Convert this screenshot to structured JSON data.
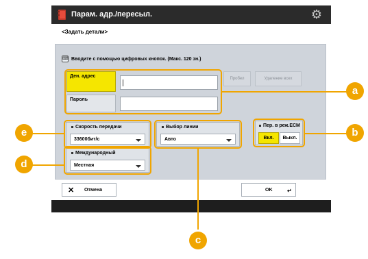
{
  "header": {
    "title": "Парам. адр./пересыл."
  },
  "subtitle": "<Задать детали>",
  "hint": "Вводите с помощью цифровых кнопок. (Макс. 120 зн.)",
  "fields": {
    "dest_label": "Ден. адрес",
    "password_label": "Пароль",
    "dest_value": "",
    "password_value": ""
  },
  "buttons": {
    "space": "Пробел",
    "delete_all": "Удаление всех",
    "cancel": "Отмена",
    "ok": "OK"
  },
  "speed": {
    "label": "Скорость передачи",
    "value": "33600бит/с"
  },
  "selection": {
    "label": "Выбор линии",
    "value": "Авто"
  },
  "international": {
    "label": "Международный",
    "value": "Местная"
  },
  "ecm": {
    "label": "Пер. в реж.ECM",
    "on": "Вкл.",
    "off": "Выкл."
  },
  "callouts": [
    "a",
    "b",
    "c",
    "d",
    "e"
  ],
  "colors": {
    "accent": "#f0a500",
    "selected": "#f5e600",
    "titlebar": "#2b2b2b"
  },
  "icons": {
    "app": "fax-book-icon",
    "settings": "gear-icon",
    "key": "keyboard-icon",
    "cancel": "close-icon",
    "ok": "enter-icon"
  }
}
